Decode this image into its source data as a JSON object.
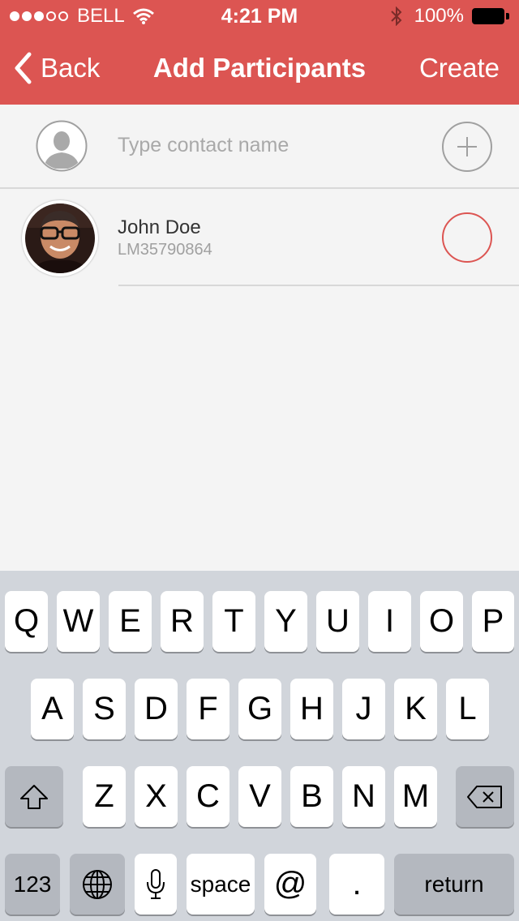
{
  "status_bar": {
    "carrier": "BELL",
    "time": "4:21 PM",
    "battery": "100%"
  },
  "nav": {
    "back_label": "Back",
    "title": "Add Participants",
    "create_label": "Create"
  },
  "search": {
    "placeholder": "Type contact name",
    "value": ""
  },
  "contacts": [
    {
      "name": "John Doe",
      "id": "LM35790864",
      "selected": false
    }
  ],
  "keyboard": {
    "row1": [
      "Q",
      "W",
      "E",
      "R",
      "T",
      "Y",
      "U",
      "I",
      "O",
      "P"
    ],
    "row2": [
      "A",
      "S",
      "D",
      "F",
      "G",
      "H",
      "J",
      "K",
      "L"
    ],
    "row3": [
      "Z",
      "X",
      "C",
      "V",
      "B",
      "N",
      "M"
    ],
    "numbers_label": "123",
    "space_label": "space",
    "at_label": "@",
    "dot_label": ".",
    "return_label": "return"
  },
  "colors": {
    "accent": "#dc5552",
    "background": "#f4f4f4",
    "keyboard_bg": "#d1d5db"
  }
}
